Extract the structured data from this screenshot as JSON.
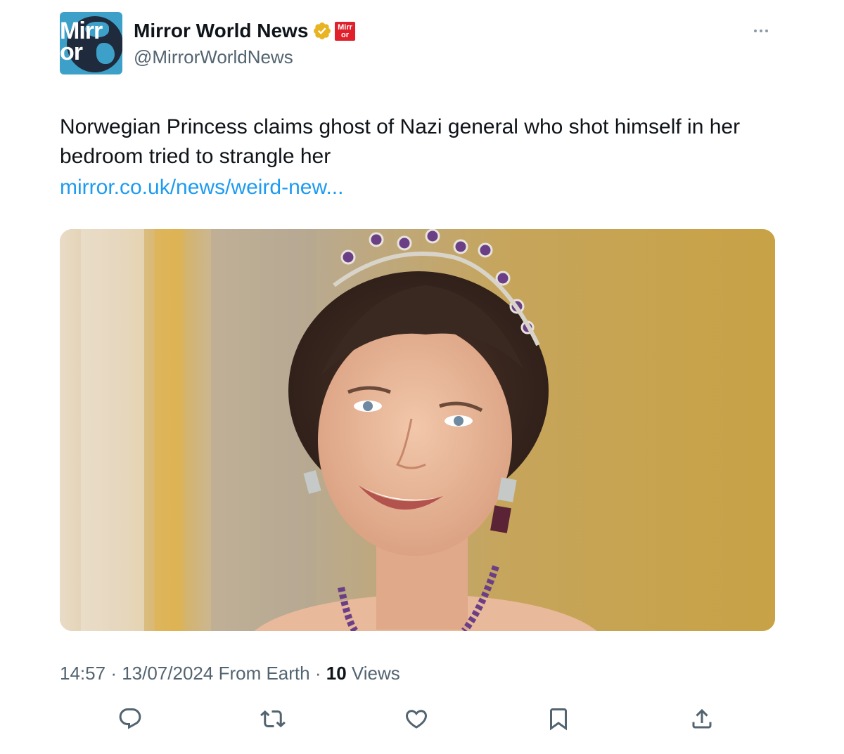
{
  "author": {
    "avatar_text": "Mirr or",
    "name": "Mirror World News",
    "handle": "@MirrorWorldNews",
    "verified_icon": "verified-badge-icon",
    "verified_color": "#e8b422",
    "affiliation_text": "Mirr or",
    "affiliation_color": "#e0202b"
  },
  "tweet": {
    "text": "Norwegian Princess claims ghost of Nazi general who shot himself in her bedroom tried to strangle her",
    "link": "mirror.co.uk/news/weird-new...",
    "link_color": "#1d9bf0"
  },
  "meta": {
    "time": "14:57",
    "date": "13/07/2024",
    "source": "From Earth",
    "views_count": "10",
    "views_label": "Views"
  },
  "actions": [
    "reply-icon",
    "retweet-icon",
    "like-icon",
    "bookmark-icon",
    "share-icon"
  ],
  "colors": {
    "secondary_text": "#536471",
    "icon": "#536471"
  }
}
